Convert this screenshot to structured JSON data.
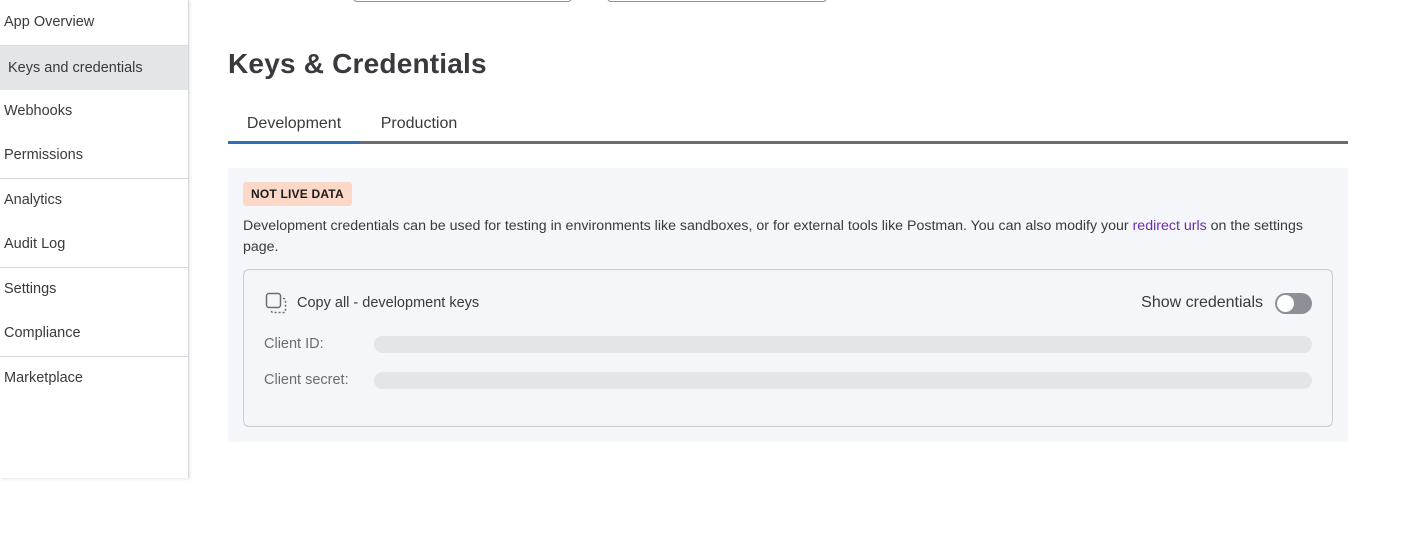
{
  "sidebar": {
    "items": [
      {
        "label": "App Overview"
      },
      {
        "label": "Keys and credentials"
      },
      {
        "label": "Webhooks"
      },
      {
        "label": "Permissions"
      },
      {
        "label": "Analytics"
      },
      {
        "label": "Audit Log"
      },
      {
        "label": "Settings"
      },
      {
        "label": "Compliance"
      },
      {
        "label": "Marketplace"
      }
    ],
    "active_index": 1
  },
  "main": {
    "title": "Keys & Credentials",
    "tabs": [
      {
        "label": "Development",
        "active": true
      },
      {
        "label": "Production",
        "active": false
      }
    ],
    "badge": "NOT LIVE DATA",
    "description_before": "Development credentials can be used for testing in environments like sandboxes, or for external tools like Postman. You can also modify your ",
    "description_link": "redirect urls",
    "description_after": " on the settings page.",
    "copy_all_label": "Copy all - development keys",
    "show_credentials_label": "Show credentials",
    "show_credentials_on": false,
    "fields": [
      {
        "label": "Client ID:"
      },
      {
        "label": "Client secret:"
      }
    ]
  },
  "icons": {
    "copy": "copy-icon"
  },
  "colors": {
    "active_tab_underline": "#2d6fb6",
    "link": "#6b2ea5",
    "badge_bg": "#fbd8c7",
    "panel_bg": "#f4f6f9",
    "toggle_off": "#8d9096"
  }
}
